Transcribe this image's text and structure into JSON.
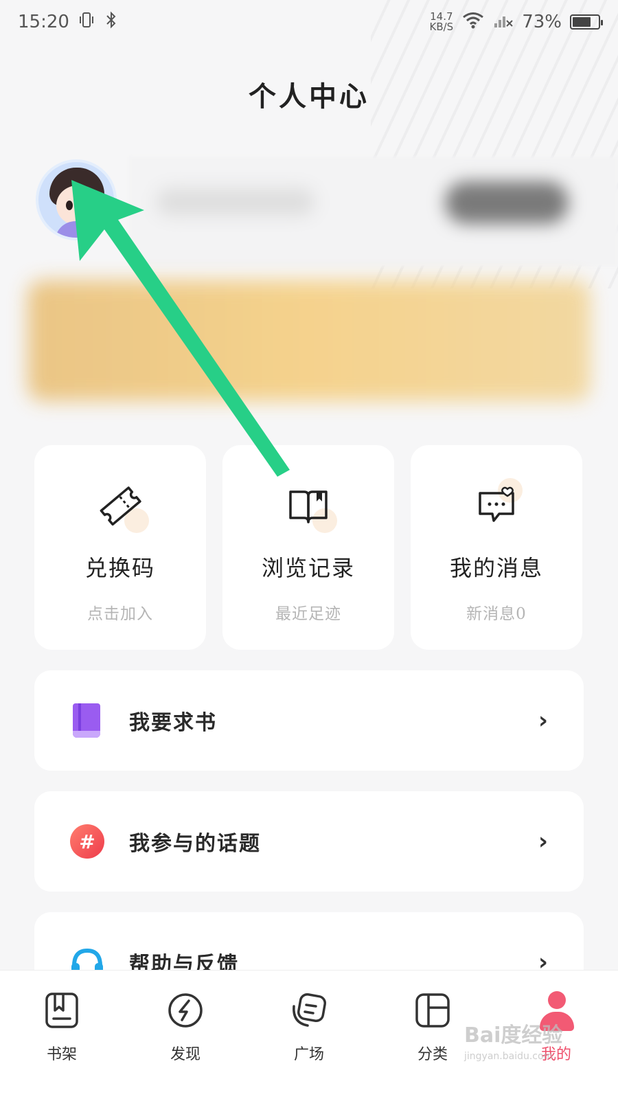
{
  "status_bar": {
    "time": "15:20",
    "net_speed_value": "14.7",
    "net_speed_unit": "KB/S",
    "battery": "73%",
    "battery_level": 0.73
  },
  "page_title": "个人中心",
  "quick_cards": [
    {
      "title": "兑换码",
      "subtitle": "点击加入",
      "icon": "ticket-icon"
    },
    {
      "title": "浏览记录",
      "subtitle": "最近足迹",
      "icon": "book-open-icon"
    },
    {
      "title": "我的消息",
      "subtitle": "新消息0",
      "icon": "message-heart-icon"
    }
  ],
  "menu": {
    "request_book": "我要求书",
    "my_topics": "我参与的话题",
    "help_feedback": "帮助与反馈",
    "chevron": "›"
  },
  "bottom_nav": [
    {
      "label": "书架",
      "icon": "bookshelf-icon"
    },
    {
      "label": "发现",
      "icon": "compass-icon"
    },
    {
      "label": "广场",
      "icon": "square-chat-icon"
    },
    {
      "label": "分类",
      "icon": "category-icon"
    },
    {
      "label": "我的",
      "icon": "user-icon",
      "active": true
    }
  ],
  "colors": {
    "accent_active": "#ef4f6b",
    "arrow": "#27cf87",
    "book_icon": "#9a5cf0",
    "hash_icon": "#ee3c4b"
  },
  "watermark": {
    "brand": "Bai度经验",
    "url": "jingyan.baidu.com"
  }
}
